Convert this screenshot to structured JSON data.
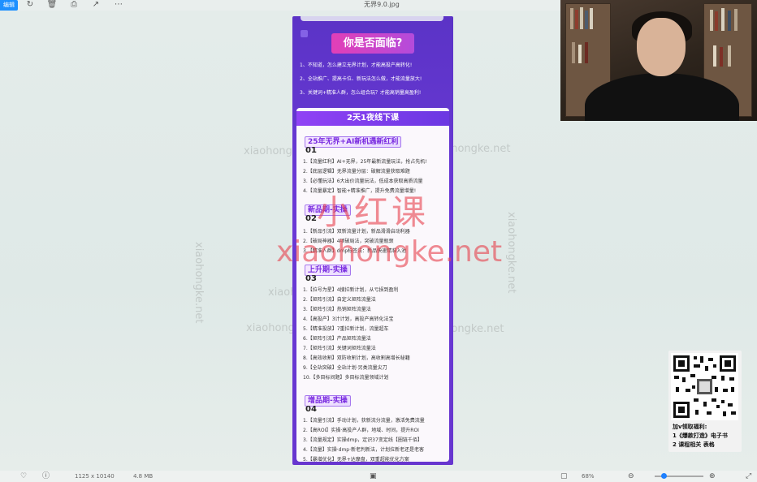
{
  "toolbar": {
    "edit_label": "编辑",
    "file_title": "无界9.0.jpg",
    "icons": [
      "rotate-icon",
      "delete-icon",
      "print-icon",
      "share-icon",
      "more-icon"
    ]
  },
  "watermarks": {
    "gray_text": "xiaohongke.net",
    "red_cn": "小红课",
    "red_domain": "xiaohongke.net"
  },
  "poster": {
    "face_title": "你是否面临?",
    "face_items": [
      "1、不知道，怎么建立无界计划，才能高投产高转化!",
      "2、全站推广、提高卡位、新玩法怎么做，才能流量放大!",
      "3、关键词+精准人群，怎么组合玩？才能高销量高盈利!"
    ],
    "course_bar": "2天1夜线下课",
    "sections": [
      {
        "title": "25年无界+AI新机遇新红利",
        "num": "01",
        "items": [
          "1.【流量红利】AI+无界，25年最新流量玩法，抢占先机!",
          "2.【底层逻辑】无界流量分层：破解流量获取难题",
          "3.【必懂玩法】6大出价流量玩法，低成本获取高质流量",
          "4.【流量暴定】智能+精准推广，提升免费流量增量!"
        ]
      },
      {
        "title": "新品期-实操",
        "num": "02",
        "items": [
          "1.【新品引流】双新流量计划，新品滑滑启动利器",
          "2.【破局神器】4项破局法，突破流量瓶颈",
          "3.【精准人群】dmp标签法：新品快速精准入池"
        ]
      },
      {
        "title": "上升期-实操",
        "num": "03",
        "items": [
          "1.【拉号为星】4搜拉新计划，从亏损到盈利",
          "2.【矩阵引流】自定义矩阵流量法",
          "3.【矩阵引流】热销矩阵流量法",
          "4.【高投产】3计计划，高投产高转化法宝",
          "5.【精准投放】7重拉新计划，流量超车",
          "6.【矩阵引流】产品矩阵流量法",
          "7.【矩阵引流】关键词矩阵流量法",
          "8.【高效收割】双防收割计划，高收割高增长秘籍",
          "9.【全站突破】全站计划·另类流量尖刀",
          "10.【多目标间题】多目标流量领域计划"
        ]
      },
      {
        "title": "增品期-实操",
        "num": "04",
        "items": [
          "1.【流量引流】手动计划，获新流分流量，激活免费流量",
          "2.【高ROI】实操·高投产人群，地域、时间，提升ROI",
          "3.【流量规定】实操dmp，定识37变定线【圈链千佰】",
          "4.【流量】实操·dmp·新老判新法，计划拉新老还是老客",
          "5.【暴增优化】无界+达摩盘，双重超能优化方案"
        ]
      }
    ]
  },
  "qr": {
    "caption_title": "加v领取福利:",
    "caption_lines": [
      "1《爆款打造》电子书",
      "2 课程相关 表格"
    ]
  },
  "statusbar": {
    "dimensions": "1125 x 10140",
    "filesize": "4.8 MB",
    "zoom": "68%",
    "zoom_fraction": 0.68
  }
}
